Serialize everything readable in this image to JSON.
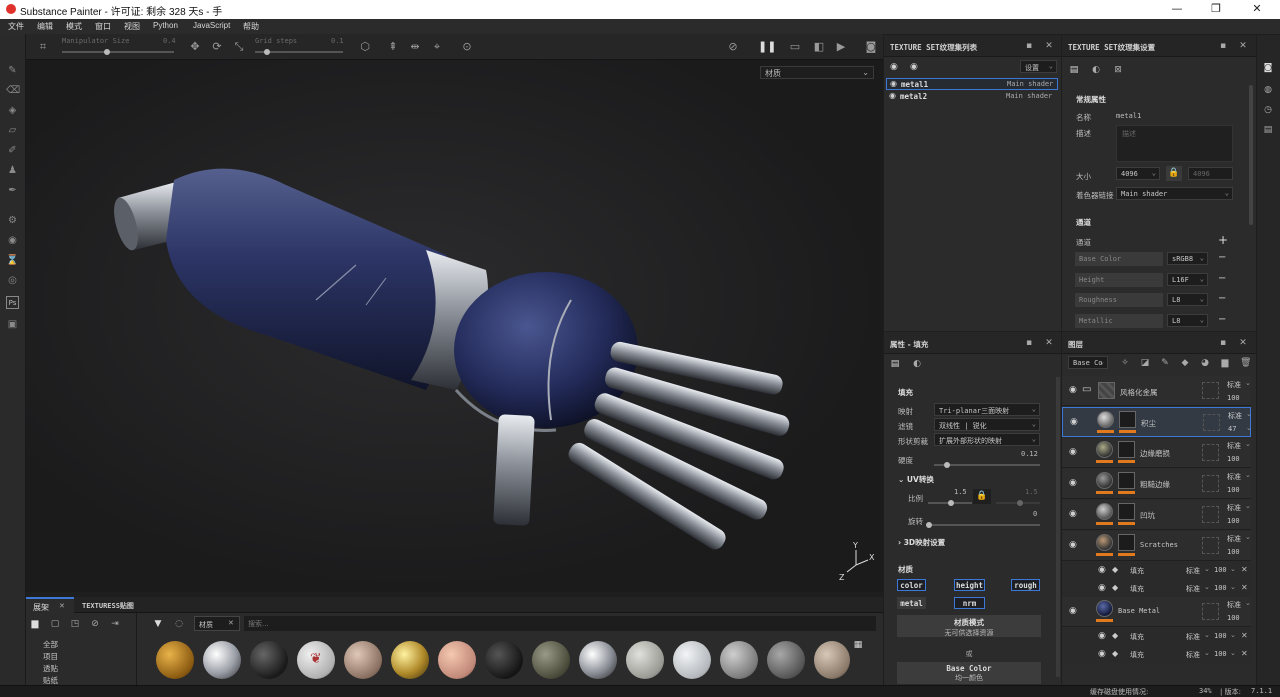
{
  "window": {
    "title": "Substance Painter - 许可证: 剩余 328 天s - 手",
    "minimize": "—",
    "maximize": "❐",
    "close": "✕"
  },
  "menu": [
    "文件",
    "编辑",
    "模式",
    "窗口",
    "视图",
    "Python",
    "JavaScript",
    "帮助"
  ],
  "viewport_toolbar": {
    "manipulator_label": "Manipulator Size",
    "manipulator_value": "0.4",
    "grid_label": "Grid steps",
    "grid_value": "0.1"
  },
  "viewport": {
    "material_dropdown": "材质"
  },
  "texture_set_list": {
    "title": "TEXTURE SET纹理集列表",
    "settings_button": "设置",
    "items": [
      {
        "name": "metal1",
        "shader": "Main shader"
      },
      {
        "name": "metal2",
        "shader": "Main shader"
      }
    ]
  },
  "texture_set_settings": {
    "title": "TEXTURE SET纹理集设置",
    "section": "常规属性",
    "name_label": "名称",
    "name_value": "metal1",
    "desc_label": "描述",
    "desc_placeholder": "描述",
    "size_label": "大小",
    "size_value": "4096",
    "size_linked": "4096",
    "shader_label": "着色器链接",
    "shader_value": "Main shader",
    "channels_section": "通道",
    "channels_label": "通道",
    "channels": [
      {
        "name": "Base Color",
        "format": "sRGB8"
      },
      {
        "name": "Height",
        "format": "L16F"
      },
      {
        "name": "Roughness",
        "format": "L8"
      },
      {
        "name": "Metallic",
        "format": "L8"
      }
    ]
  },
  "properties": {
    "title": "属性 - 填充",
    "fill_section": "填充",
    "projection_label": "映射",
    "projection_value": "Tri-planar三面映射",
    "filter_label": "滤镜",
    "filter_value": "双线性 | 锐化",
    "shape_label": "形状剪裁",
    "shape_value": "扩展外部形状的映射",
    "hardness_label": "硬度",
    "hardness_value": "0.12",
    "uv_section": "UV转换",
    "scale_label": "比例",
    "scale_value": "1.5",
    "scale_value2": "1.5",
    "rotate_label": "旋转",
    "rotate_value": "0",
    "projection3d_section": "3D映射设置",
    "material_section": "材质",
    "chips": [
      "color",
      "height",
      "rough",
      "metal",
      "nrm"
    ],
    "material_mode_label": "材质模式",
    "material_mode_value": "无可供选择资源",
    "or_label": "或",
    "base_color_label": "Base Color",
    "base_color_value": "均一颜色"
  },
  "layers": {
    "title": "图层",
    "channel_dropdown": "Base Co",
    "rows": [
      {
        "name": "风格化金属",
        "blend": "标准",
        "opacity": "100",
        "type": "folder"
      },
      {
        "name": "积尘",
        "blend": "标准",
        "opacity": "47",
        "type": "layer"
      },
      {
        "name": "边缘磨损",
        "blend": "标准",
        "opacity": "100",
        "type": "layer"
      },
      {
        "name": "粗糙边缘",
        "blend": "标准",
        "opacity": "100",
        "type": "layer"
      },
      {
        "name": "凹坑",
        "blend": "标准",
        "opacity": "100",
        "type": "layer"
      },
      {
        "name": "Scratches",
        "blend": "标准",
        "opacity": "100",
        "type": "layer"
      },
      {
        "name": "填充",
        "blend": "标准",
        "opacity": "100",
        "type": "effect"
      },
      {
        "name": "填充",
        "blend": "标准",
        "opacity": "100",
        "type": "effect"
      },
      {
        "name": "Base Metal",
        "blend": "标准",
        "opacity": "100",
        "type": "layer"
      },
      {
        "name": "填充",
        "blend": "标准",
        "opacity": "100",
        "type": "effect"
      },
      {
        "name": "填充",
        "blend": "标准",
        "opacity": "100",
        "type": "effect"
      }
    ]
  },
  "shelf": {
    "tab1": "展架",
    "tab2": "TEXTURESS贴图",
    "categories": [
      "全部",
      "项目",
      "透贴",
      "贴纸"
    ],
    "filter_tag": "材质",
    "search_placeholder": "搜索..."
  },
  "status": {
    "label": "缓存磁盘使用情况:",
    "value": "34%",
    "version_label": "| 版本:",
    "version": "7.1.1"
  },
  "colors": {
    "accent": "#3b78d8",
    "orange": "#e07a1d",
    "bg": "#2b2b2b"
  }
}
